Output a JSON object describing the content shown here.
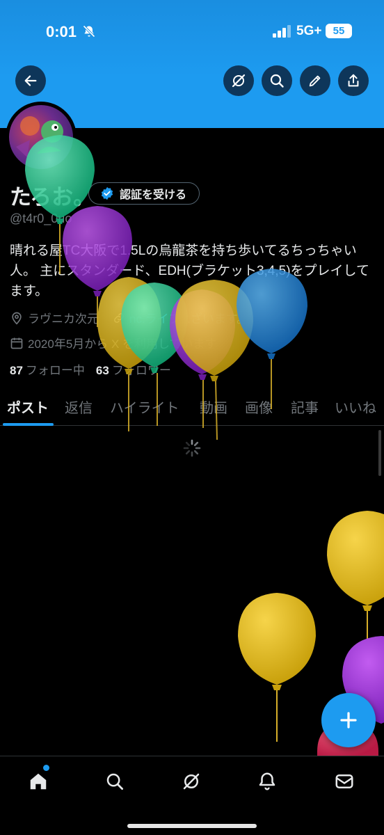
{
  "status_bar": {
    "time": "0:01",
    "network": "5G+",
    "battery": "55"
  },
  "profile": {
    "display_name": "たろお。",
    "verify_label": "認証を受ける",
    "handle": "@t4r0_0uo",
    "bio": "晴れる屋TC大阪で1.5Lの烏龍茶を持ち歩いてるちっちゃい人。 主にスタンダード、EDH(ブラケット3,4,5)をプレイしてます。",
    "location": "ラヴニカ次元",
    "website": "nc.ライブ...ざいます。",
    "joined": "2020年5月から X を利用しています",
    "following_count": "87",
    "following_label": "フォロー中",
    "followers_count": "63",
    "followers_label": "フォロワー"
  },
  "tabs": [
    {
      "label": "ポスト",
      "active": true
    },
    {
      "label": "返信"
    },
    {
      "label": "ハイライト"
    },
    {
      "label": "動画"
    },
    {
      "label": "画像"
    },
    {
      "label": "記事"
    },
    {
      "label": "いいね"
    }
  ],
  "icons": {
    "back": "arrow-left-icon",
    "grok": "grok-icon",
    "search": "search-icon",
    "edit": "pencil-icon",
    "share": "share-icon",
    "compose": "plus-icon",
    "nav": [
      "home-icon",
      "search-icon",
      "grok-icon",
      "bell-icon",
      "mail-icon"
    ]
  },
  "colors": {
    "accent": "#1d9bf0",
    "background": "#000000",
    "text": "#e7e9ea",
    "muted": "#71767b"
  }
}
